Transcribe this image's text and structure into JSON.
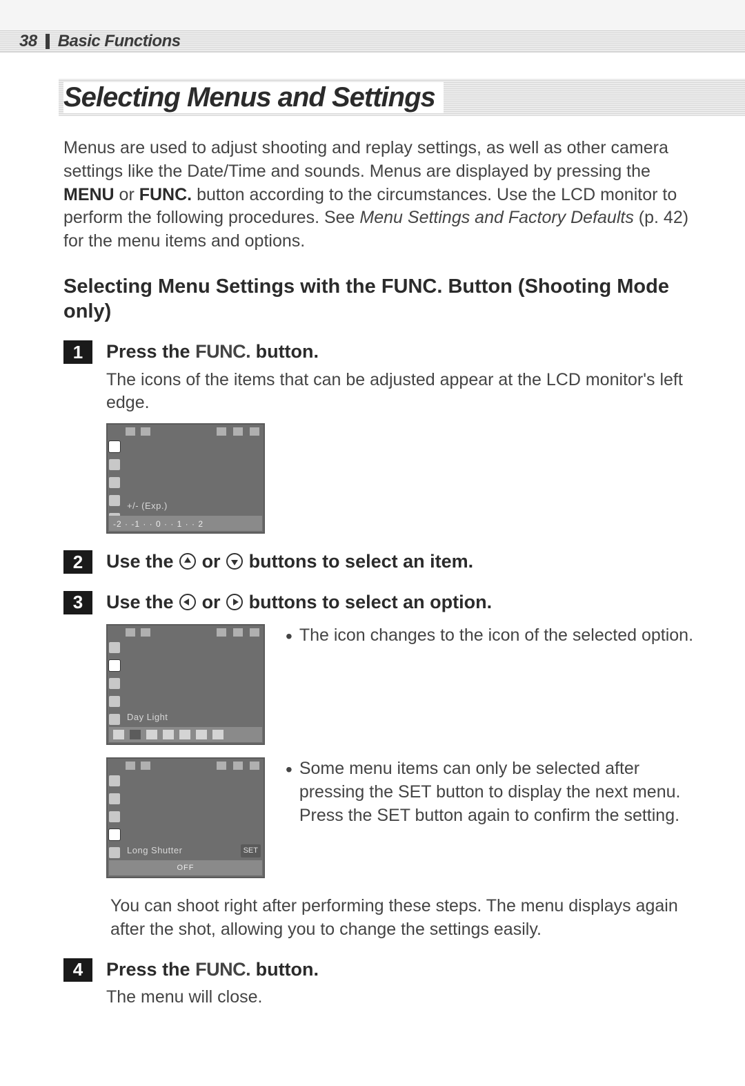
{
  "header": {
    "page_number": "38",
    "section": "Basic Functions"
  },
  "title": "Selecting Menus and Settings",
  "intro": {
    "line1": "Menus are used to adjust shooting and replay settings, as well as other camera settings like the Date/Time and sounds. Menus are displayed by pressing the ",
    "bold1": "MENU",
    "mid1": " or ",
    "bold2": "FUNC.",
    "line2": " button according to the circumstances. Use the LCD monitor to perform the following procedures. See ",
    "italic1": "Menu Settings and Factory Defaults",
    "line3": " (p. 42) for the menu items and options."
  },
  "sub_heading": "Selecting Menu Settings with the FUNC. Button (Shooting Mode only)",
  "steps": [
    {
      "num": "1",
      "title_pre": "Press the ",
      "title_btn": "FUNC.",
      "title_post": " button.",
      "desc": "The icons of the items that can be adjusted appear at the LCD monitor's left edge.",
      "lcd_label": "+/- (Exp.)",
      "lcd_scale": "-2 · -1 · · 0 · · 1 · · 2"
    },
    {
      "num": "2",
      "title_pre": "Use the ",
      "title_mid": " or ",
      "title_post": " buttons to select an item."
    },
    {
      "num": "3",
      "title_pre": "Use the ",
      "title_mid": " or ",
      "title_post": " buttons to select an option.",
      "bullet1": "The icon changes to the icon of the selected option.",
      "bullet2_pre": "Some menu items can only be selected after pressing the ",
      "bullet2_b1": "SET",
      "bullet2_mid": " button to display the next menu. Press the ",
      "bullet2_b2": "SET",
      "bullet2_post": " button again to confirm the setting.",
      "lcd1_label": "Day Light",
      "lcd2_label": "Long Shutter",
      "lcd2_set": "SET",
      "lcd2_off": "OFF"
    },
    {
      "num": "4",
      "title_pre": "Press the ",
      "title_btn": "FUNC.",
      "title_post": " button.",
      "desc": "The menu will close."
    }
  ],
  "after_step3": "You can shoot right after performing these steps. The menu displays again after the shot, allowing you to change the settings easily."
}
